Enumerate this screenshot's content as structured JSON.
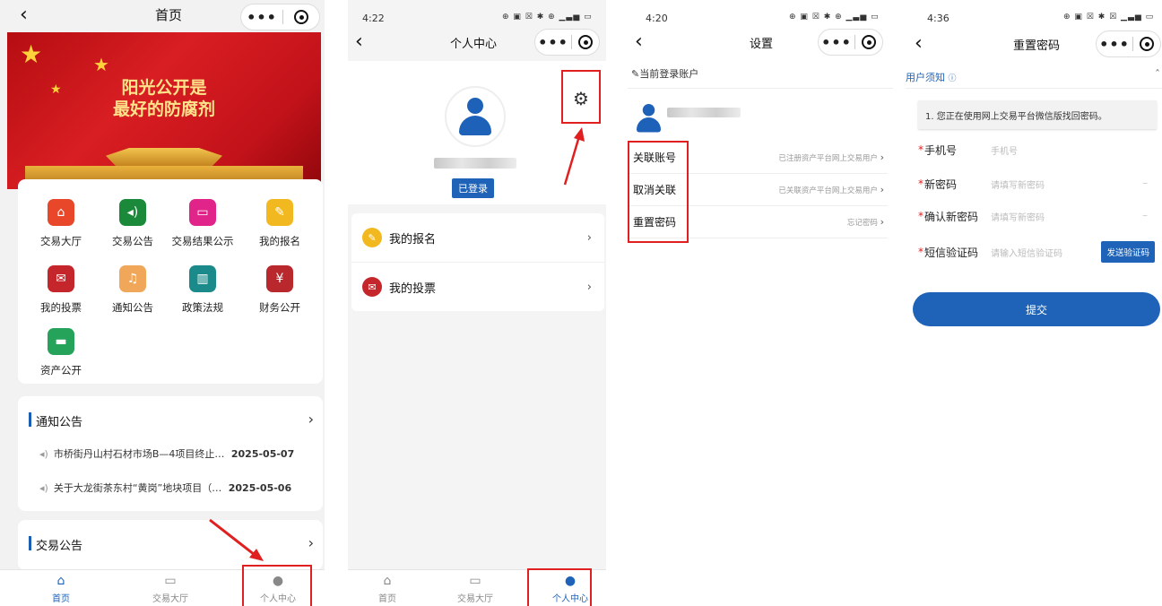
{
  "panel1": {
    "title": "首页",
    "banner_line1": "阳光公开是",
    "banner_line2": "最好的防腐剂",
    "grid": [
      {
        "label": "交易大厅",
        "icon": "bank-icon",
        "color": "#e8472a"
      },
      {
        "label": "交易公告",
        "icon": "speaker-icon",
        "color": "#1a8a3a"
      },
      {
        "label": "交易结果公示",
        "icon": "monitor-icon",
        "color": "#e0248a"
      },
      {
        "label": "我的报名",
        "icon": "signup-icon",
        "color": "#f2b81f"
      },
      {
        "label": "我的投票",
        "icon": "vote-icon",
        "color": "#c5262b"
      },
      {
        "label": "通知公告",
        "icon": "bell-icon",
        "color": "#f0a75a"
      },
      {
        "label": "政策法规",
        "icon": "book-icon",
        "color": "#1a8a8a"
      },
      {
        "label": "财务公开",
        "icon": "finance-icon",
        "color": "#b8282d"
      },
      {
        "label": "资产公开",
        "icon": "briefcase-icon",
        "color": "#25a35a"
      }
    ],
    "notice_section": {
      "title": "通知公告",
      "items": [
        {
          "text": "市桥街丹山村石材市场B—4项目终止…",
          "date": "2025-05-07"
        },
        {
          "text": "关于大龙街茶东村“黄岗”地块项目（…",
          "date": "2025-05-06"
        }
      ]
    },
    "trade_section": {
      "title": "交易公告"
    },
    "tabs": [
      {
        "label": "首页",
        "icon": "home-icon"
      },
      {
        "label": "交易大厅",
        "icon": "monitor-icon"
      },
      {
        "label": "个人中心",
        "icon": "person-icon"
      }
    ]
  },
  "panel2": {
    "time": "4:22",
    "status_icons": "⊕ ▣ ☒ ✱ ⊕ ▁▃▅ ▭",
    "title": "个人中心",
    "badge": "已登录",
    "menu": [
      {
        "label": "我的报名",
        "icon": "signup-icon",
        "color": "#f2b81f"
      },
      {
        "label": "我的投票",
        "icon": "vote-icon",
        "color": "#c5262b"
      }
    ],
    "tabs": [
      {
        "label": "首页",
        "icon": "home-icon"
      },
      {
        "label": "交易大厅",
        "icon": "monitor-icon"
      },
      {
        "label": "个人中心",
        "icon": "person-icon"
      }
    ]
  },
  "panel3": {
    "time": "4:20",
    "status_icons": "⊕ ▣ ☒ ✱ ⊕ ▁▃▅ ▭",
    "title": "设置",
    "account_header": "当前登录账户",
    "rows": [
      {
        "label": "关联账号",
        "hint": "已注册资产平台网上交易用户"
      },
      {
        "label": "取消关联",
        "hint": "已关联资产平台网上交易用户"
      },
      {
        "label": "重置密码",
        "hint": "忘记密码"
      }
    ]
  },
  "panel4": {
    "time": "4:36",
    "status_icons": "⊕ ▣ ☒ ✱ ☒ ▁▃▅ ▭",
    "title": "重置密码",
    "notice_label": "用户须知",
    "notice_text": "1. 您正在使用网上交易平台微信版找回密码。",
    "fields": [
      {
        "label": "手机号",
        "placeholder": "手机号"
      },
      {
        "label": "新密码",
        "placeholder": "请填写新密码"
      },
      {
        "label": "确认新密码",
        "placeholder": "请填写新密码"
      },
      {
        "label": "短信验证码",
        "placeholder": "请输入短信验证码"
      }
    ],
    "sms_button": "发送验证码",
    "submit": "提交"
  },
  "capsule": {
    "dots": "•••"
  },
  "accent_color": "#1e63b8",
  "highlight_color": "#e02020"
}
